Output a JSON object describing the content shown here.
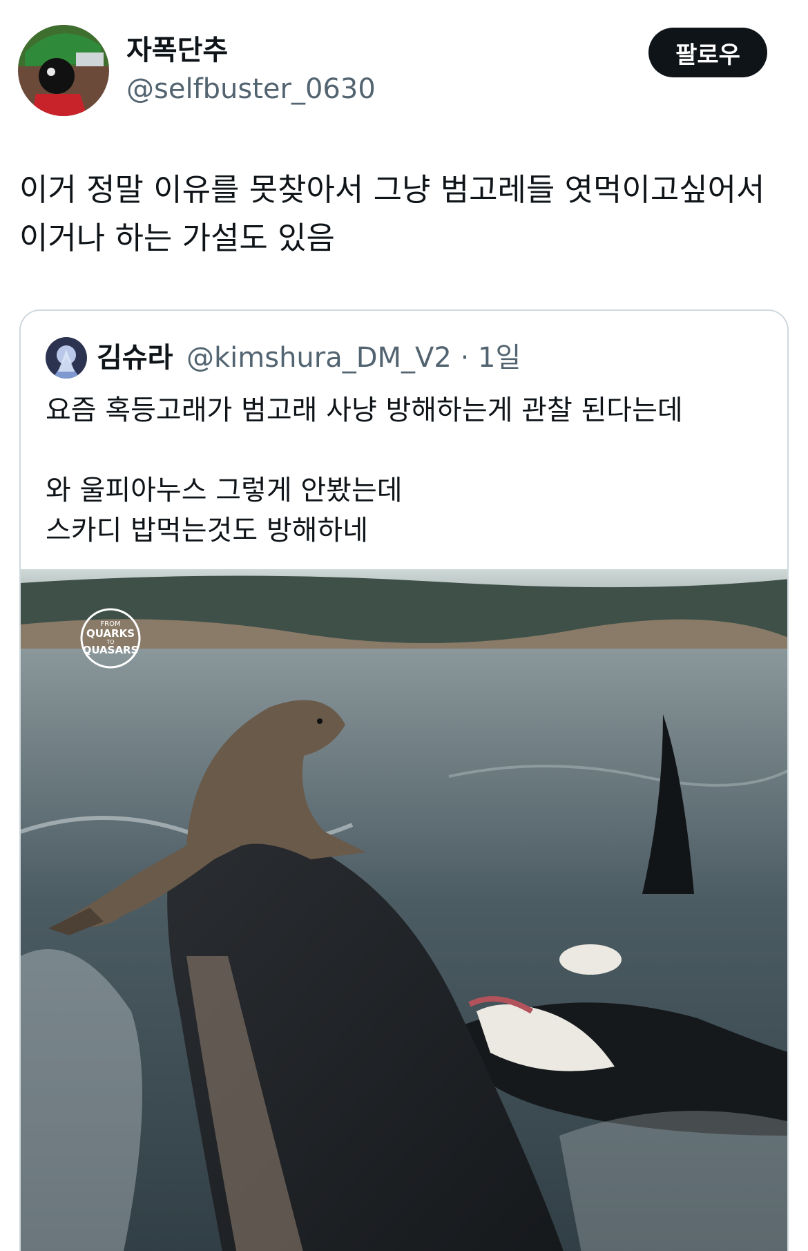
{
  "tweet": {
    "author": {
      "display_name": "자폭단추",
      "handle": "@selfbuster_0630",
      "avatar_icon": "avatar-icon"
    },
    "follow_label": "팔로우",
    "text": "이거 정말 이유를 못찾아서 그냥 범고레들 엿먹이고싶어서 이거나 하는 가설도 있음"
  },
  "quote": {
    "author": {
      "display_name": "김슈라",
      "handle": "@kimshura_DM_V2",
      "time": "1일",
      "avatar_icon": "avatar-icon"
    },
    "lines": [
      "요즘 혹등고래가 범고래 사냥 방해하는게 관찰 된다는데",
      "와 울피아누스 그렇게 안봤는데",
      "스카디 밥먹는것도 방해하네"
    ],
    "meta_separator": "·",
    "image": {
      "watermark_text": [
        "FROM",
        "QUARKS",
        "TO",
        "QUASARS"
      ]
    }
  },
  "colors": {
    "text": "#0f1419",
    "secondary": "#536471",
    "border": "#cfd9de",
    "button_bg": "#0f1419"
  }
}
